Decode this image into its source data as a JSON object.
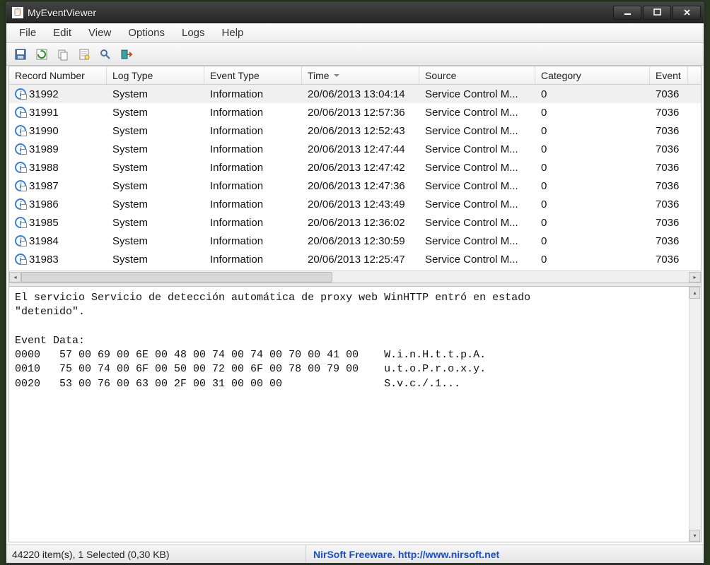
{
  "titlebar": {
    "title": "MyEventViewer"
  },
  "menu": {
    "file": "File",
    "edit": "Edit",
    "view": "View",
    "options": "Options",
    "logs": "Logs",
    "help": "Help"
  },
  "columns": {
    "record": "Record Number",
    "log": "Log Type",
    "event": "Event Type",
    "time": "Time",
    "source": "Source",
    "category": "Category",
    "eventid": "Event"
  },
  "rows": [
    {
      "record": "31992",
      "log": "System",
      "event": "Information",
      "time": "20/06/2013 13:04:14",
      "source": "Service Control M...",
      "category": "0",
      "eid": "7036"
    },
    {
      "record": "31991",
      "log": "System",
      "event": "Information",
      "time": "20/06/2013 12:57:36",
      "source": "Service Control M...",
      "category": "0",
      "eid": "7036"
    },
    {
      "record": "31990",
      "log": "System",
      "event": "Information",
      "time": "20/06/2013 12:52:43",
      "source": "Service Control M...",
      "category": "0",
      "eid": "7036"
    },
    {
      "record": "31989",
      "log": "System",
      "event": "Information",
      "time": "20/06/2013 12:47:44",
      "source": "Service Control M...",
      "category": "0",
      "eid": "7036"
    },
    {
      "record": "31988",
      "log": "System",
      "event": "Information",
      "time": "20/06/2013 12:47:42",
      "source": "Service Control M...",
      "category": "0",
      "eid": "7036"
    },
    {
      "record": "31987",
      "log": "System",
      "event": "Information",
      "time": "20/06/2013 12:47:36",
      "source": "Service Control M...",
      "category": "0",
      "eid": "7036"
    },
    {
      "record": "31986",
      "log": "System",
      "event": "Information",
      "time": "20/06/2013 12:43:49",
      "source": "Service Control M...",
      "category": "0",
      "eid": "7036"
    },
    {
      "record": "31985",
      "log": "System",
      "event": "Information",
      "time": "20/06/2013 12:36:02",
      "source": "Service Control M...",
      "category": "0",
      "eid": "7036"
    },
    {
      "record": "31984",
      "log": "System",
      "event": "Information",
      "time": "20/06/2013 12:30:59",
      "source": "Service Control M...",
      "category": "0",
      "eid": "7036"
    },
    {
      "record": "31983",
      "log": "System",
      "event": "Information",
      "time": "20/06/2013 12:25:47",
      "source": "Service Control M...",
      "category": "0",
      "eid": "7036"
    }
  ],
  "details_text": "El servicio Servicio de detección automática de proxy web WinHTTP entró en estado\n\"detenido\".\n\nEvent Data:\n0000   57 00 69 00 6E 00 48 00 74 00 74 00 70 00 41 00    W.i.n.H.t.t.p.A.\n0010   75 00 74 00 6F 00 50 00 72 00 6F 00 78 00 79 00    u.t.o.P.r.o.x.y.\n0020   53 00 76 00 63 00 2F 00 31 00 00 00                S.v.c./.1...",
  "status": {
    "left": "44220 item(s), 1 Selected  (0,30 KB)",
    "right_text": "NirSoft Freeware.  ",
    "right_link": "http://www.nirsoft.net"
  }
}
